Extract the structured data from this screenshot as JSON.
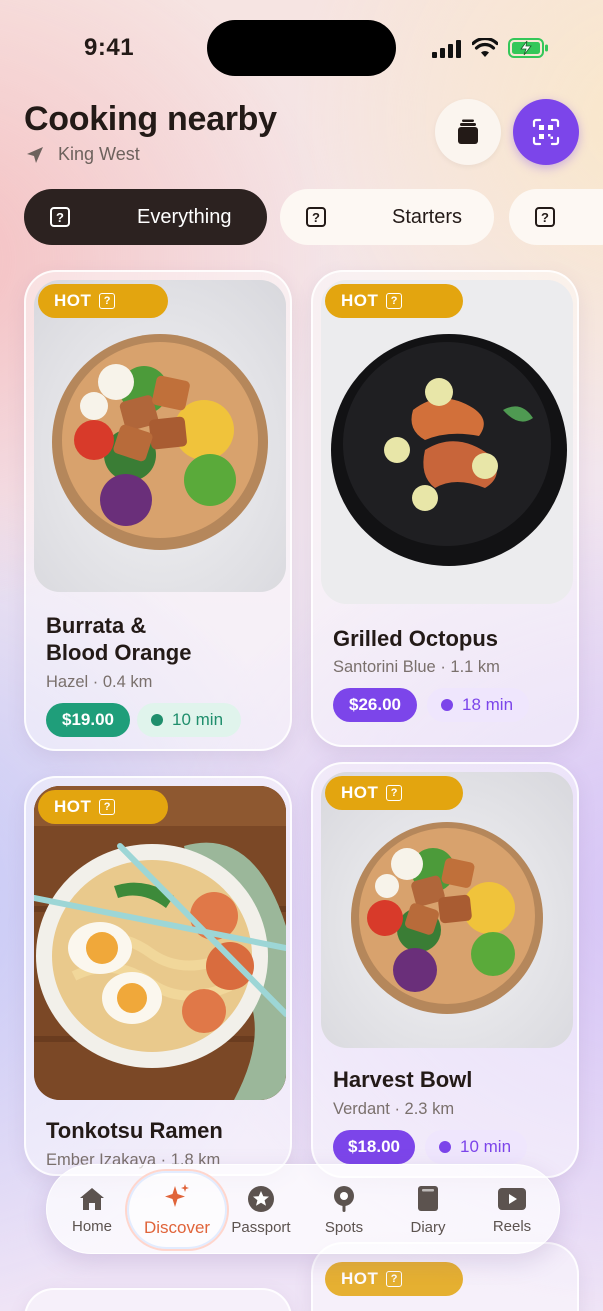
{
  "status": {
    "time": "9:41"
  },
  "header": {
    "title": "Cooking nearby",
    "location": "King West"
  },
  "colors": {
    "accent": "#7c45ea",
    "hot": "#e3a50f",
    "green": "#1f9e7a",
    "dark_chip": "#2c2220"
  },
  "chips": [
    {
      "label": "Everything",
      "icon": "question-box-icon",
      "active": true
    },
    {
      "label": "Starters",
      "icon": "question-box-icon",
      "active": false
    },
    {
      "label": "",
      "icon": "question-box-icon",
      "active": false
    }
  ],
  "cards": [
    {
      "badge": "HOT",
      "name_line1": "Burrata &",
      "name_line2": "Blood Orange",
      "meta": "Hazel · 0.4 km",
      "price": "$19.00",
      "eta": "10 min",
      "image": "poke-bowl"
    },
    {
      "badge": "HOT",
      "name_line1": "Grilled Octopus",
      "meta": "Santorini Blue · 1.1 km",
      "price": "$26.00",
      "eta": "18 min",
      "image": "shrimp-plate"
    },
    {
      "badge": "HOT",
      "name_line1": "Tonkotsu Ramen",
      "meta": "Ember Izakaya · 1.8 km",
      "image": "ramen-bowl"
    },
    {
      "badge": "HOT",
      "name_line1": "Harvest Bowl",
      "meta": "Verdant · 2.3 km",
      "price": "$18.00",
      "eta": "10 min",
      "image": "poke-bowl"
    },
    {
      "badge": "HOT"
    }
  ],
  "nav": [
    {
      "label": "Home",
      "icon": "home-icon"
    },
    {
      "label": "Discover",
      "icon": "sparkle-icon",
      "active": true
    },
    {
      "label": "Passport",
      "icon": "star-badge-icon"
    },
    {
      "label": "Spots",
      "icon": "pin-icon"
    },
    {
      "label": "Diary",
      "icon": "book-icon"
    },
    {
      "label": "Reels",
      "icon": "play-icon"
    }
  ]
}
